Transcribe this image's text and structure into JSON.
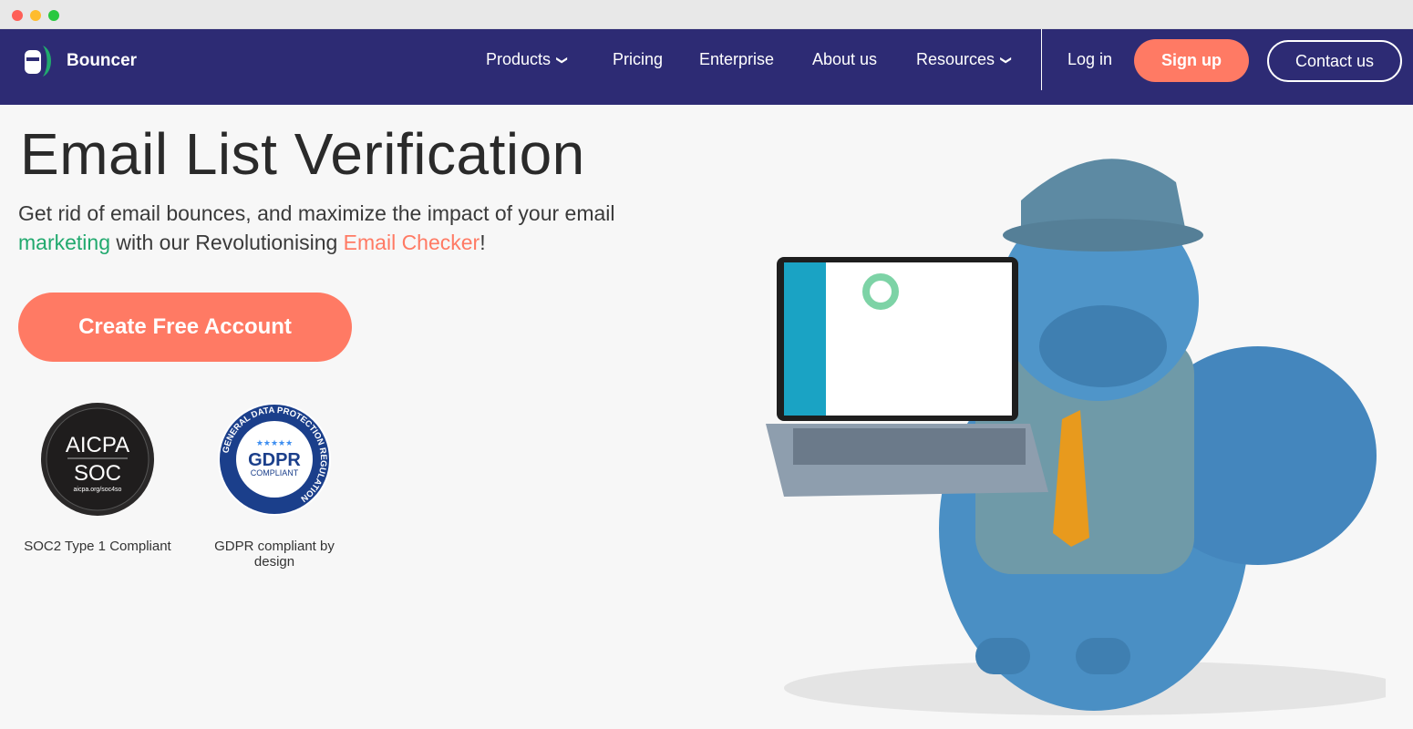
{
  "nav": {
    "brand": "Bouncer",
    "links": [
      {
        "label": "Products",
        "dropdown": true
      },
      {
        "label": "Pricing"
      },
      {
        "label": "Enterprise"
      },
      {
        "label": "About us"
      },
      {
        "label": "Resources",
        "dropdown": true
      }
    ],
    "login": "Log in",
    "signup": "Sign up",
    "contact": "Contact us"
  },
  "hero": {
    "title": "Email List Verification",
    "sub_1": "Get rid of email bounces, and maximize the impact of your email ",
    "sub_green": "marketing",
    "sub_2": " with our Revolutionising ",
    "sub_orange": "Email Checker",
    "sub_3": "!",
    "cta": "Create Free Account"
  },
  "badges": [
    {
      "line1": "AICPA",
      "line2": "SOC",
      "url": "aicpa.org/soc4so",
      "caption": "SOC2 Type 1 Compliant"
    },
    {
      "ring": "GENERAL DATA PROTECTION REGULATION",
      "stars": "★★★★★",
      "line1": "GDPR",
      "line2": "COMPLIANT",
      "caption": "GDPR compliant by design"
    }
  ],
  "colors": {
    "nav_bg": "#2d2b74",
    "accent": "#ff7a64",
    "green": "#21a96e",
    "mascot": "#4a8fc4"
  }
}
